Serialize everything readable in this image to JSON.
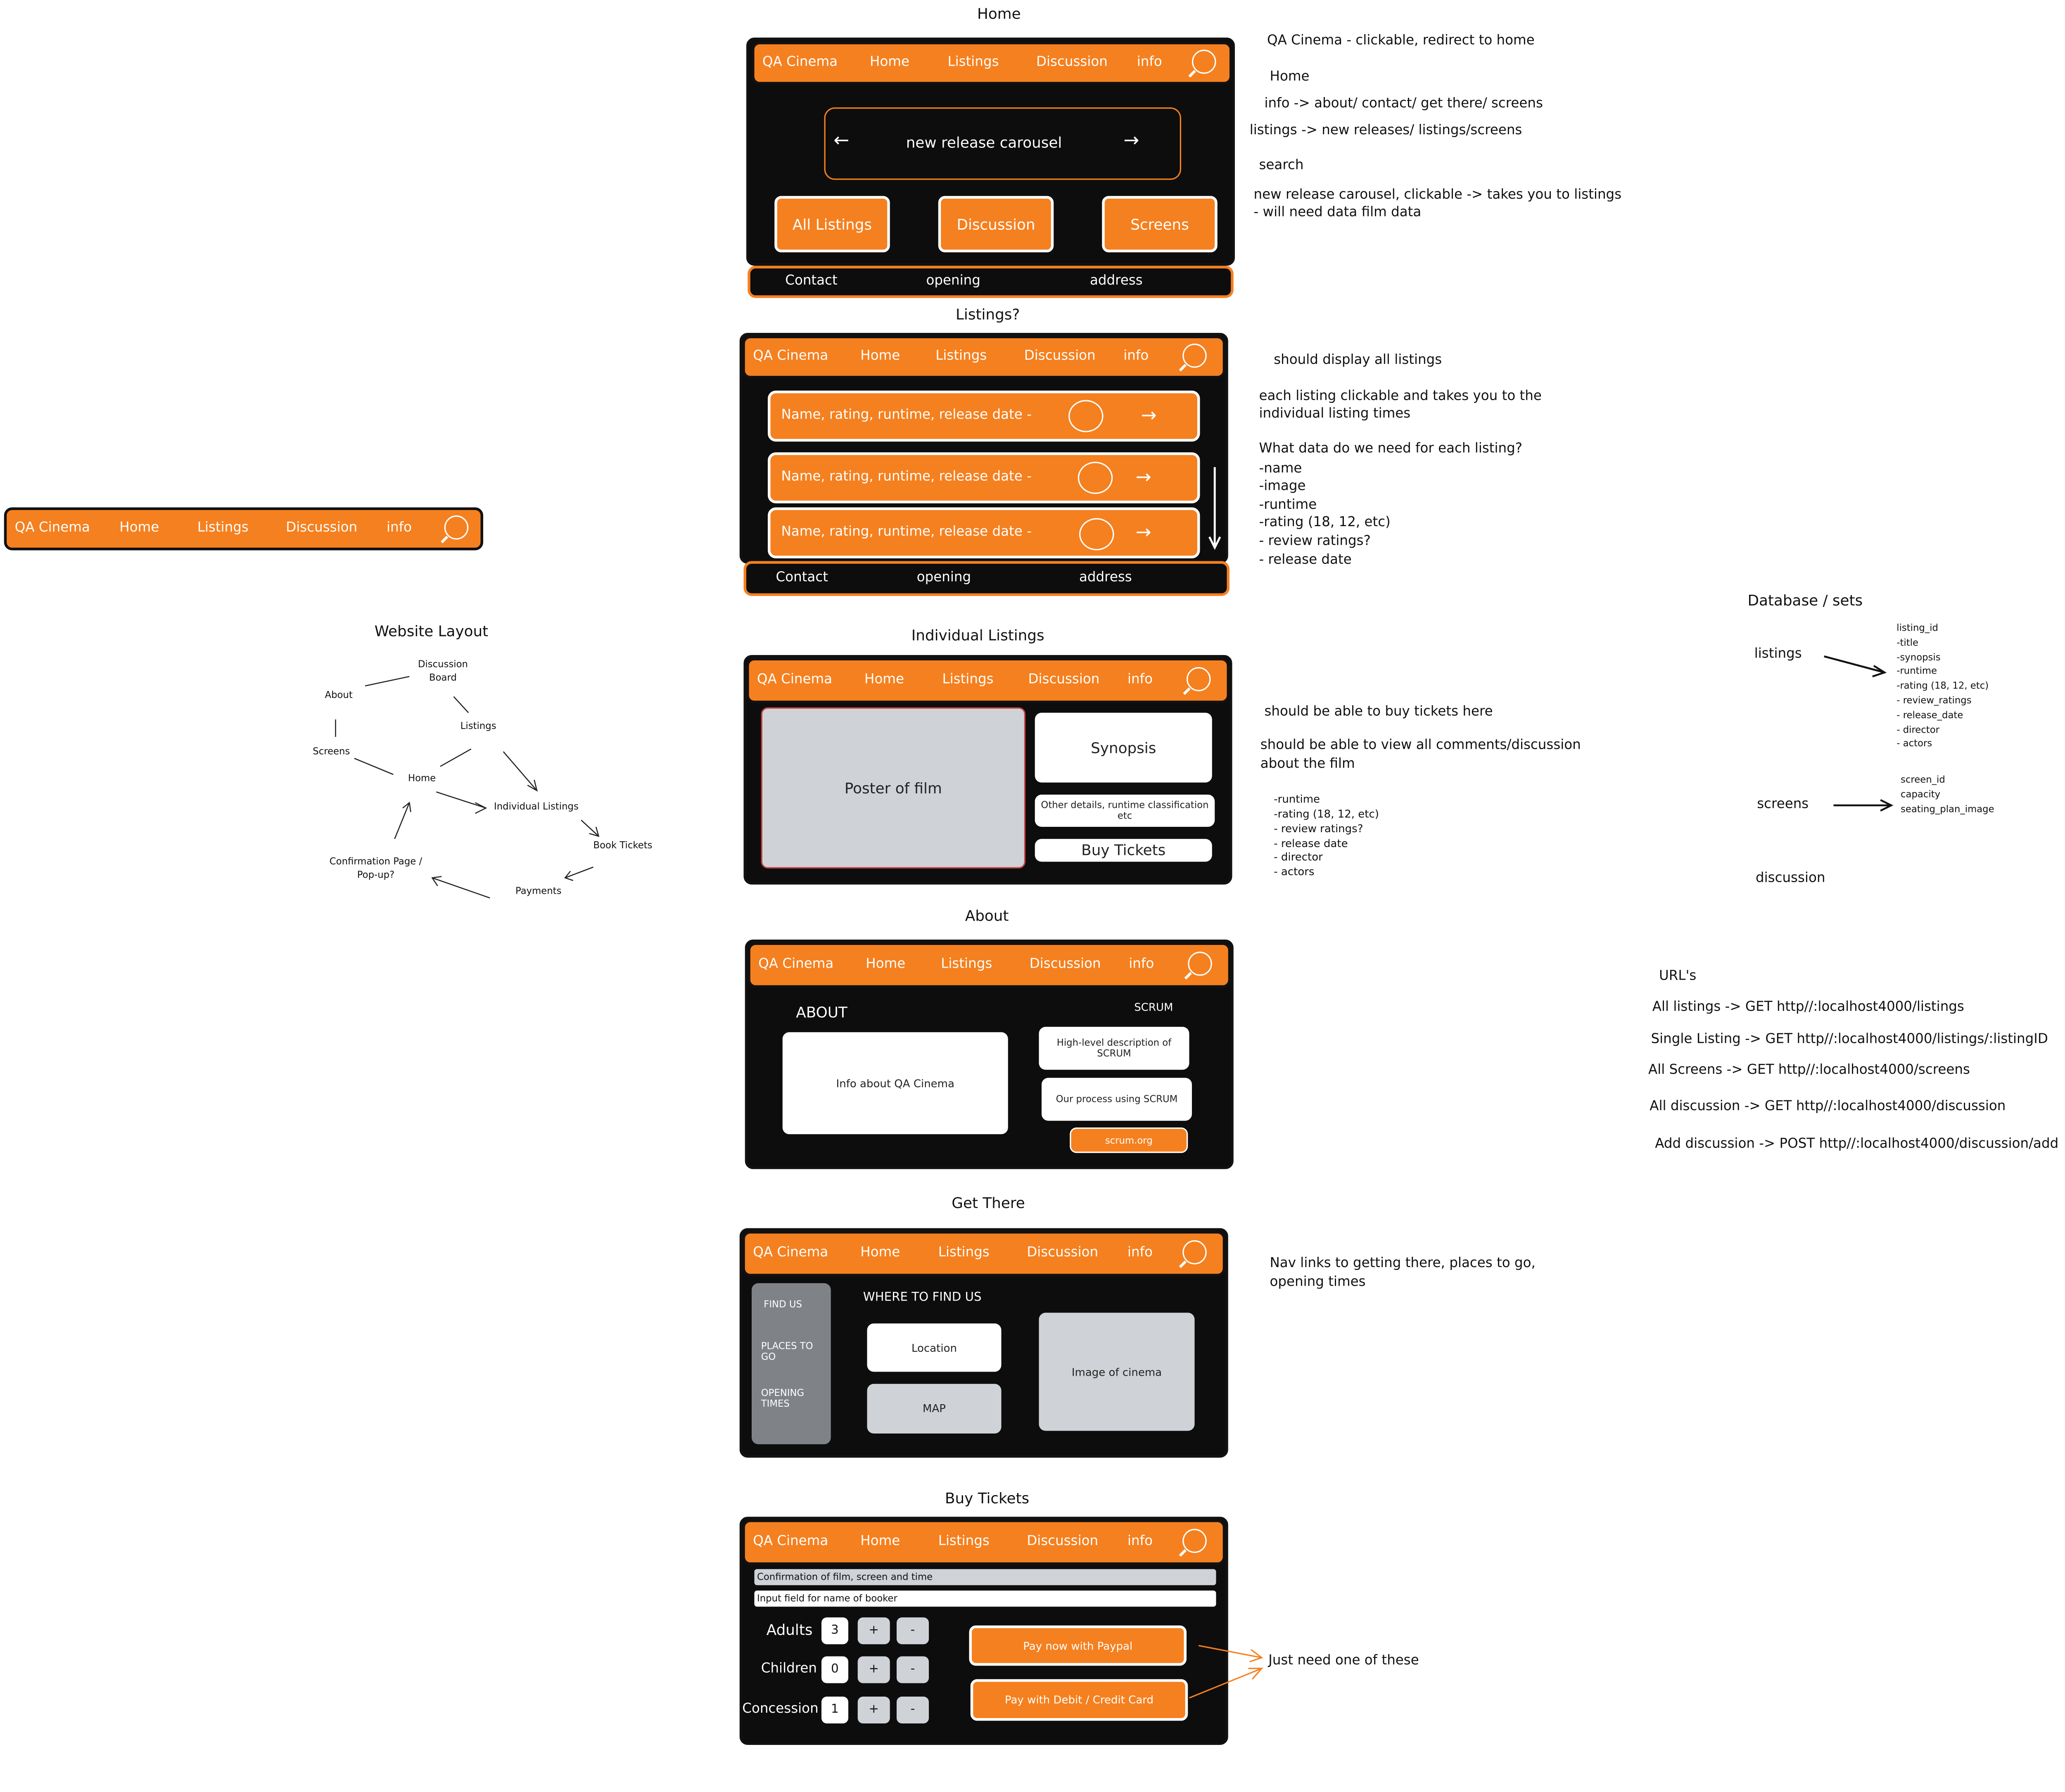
{
  "nav": {
    "logo": "QA Cinema",
    "home": "Home",
    "listings": "Listings",
    "discussion": "Discussion",
    "info": "info"
  },
  "footer": {
    "contact": "Contact",
    "opening": "opening",
    "address": "address"
  },
  "sections": {
    "home": {
      "title": "Home",
      "carousel": "new release carousel",
      "buttons": [
        "All Listings",
        "Discussion",
        "Screens"
      ],
      "notes": [
        "QA Cinema - clickable, redirect to home",
        "Home",
        "info -> about/ contact/ get there/ screens",
        "listings -> new releases/ listings/screens",
        "search",
        "new release carousel, clickable -> takes you to listings",
        "- will need data film data"
      ]
    },
    "listings": {
      "title": "Listings?",
      "row_text": "Name, rating, runtime, release date -",
      "notes": [
        "should display all listings",
        "each listing clickable and takes you to the",
        "individual listing times",
        "What data do we need for each listing?",
        "-name",
        "-image",
        "-runtime",
        "-rating (18, 12, etc)",
        "- review ratings?",
        "- release date"
      ]
    },
    "individual": {
      "title": "Individual Listings",
      "poster": "Poster of film",
      "synopsis": "Synopsis",
      "other": "Other details, runtime classification etc",
      "buy": "Buy Tickets",
      "notes": [
        "should be able to buy tickets here",
        "should be able to view all comments/discussion",
        "about the film"
      ],
      "fields": [
        "-runtime",
        "-rating (18, 12, etc)",
        "- review ratings?",
        "- release date",
        "- director",
        "- actors"
      ]
    },
    "about": {
      "title": "About",
      "heading": "ABOUT",
      "scrum": "SCRUM",
      "info": "Info about QA Cinema",
      "desc": "High-level description of SCRUM",
      "process": "Our process using SCRUM",
      "link": "scrum.org"
    },
    "get_there": {
      "title": "Get There",
      "side": [
        "FIND US",
        "PLACES TO GO",
        "OPENING TIMES"
      ],
      "heading": "WHERE TO FIND US",
      "location": "Location",
      "map": "MAP",
      "image": "Image of cinema",
      "notes": [
        "Nav links to getting there, places to go,",
        "opening times"
      ]
    },
    "buy": {
      "title": "Buy Tickets",
      "confirm": "Confirmation of film, screen and time",
      "input": "Input field for name of booker",
      "rows": [
        {
          "label": "Adults",
          "value": "3"
        },
        {
          "label": "Children",
          "value": "0"
        },
        {
          "label": "Concession",
          "value": "1"
        }
      ],
      "plus": "+",
      "minus": "-",
      "paypal": "Pay now with Paypal",
      "card": "Pay with Debit / Credit Card",
      "note": "Just need one of these"
    }
  },
  "layout": {
    "title": "Website Layout",
    "nodes": {
      "discussion": "Discussion Board",
      "about": "About",
      "listings": "Listings",
      "screens": "Screens",
      "home": "Home",
      "individual": "Individual Listings",
      "book": "Book Tickets",
      "confirmation": "Confirmation Page / Pop-up?",
      "payments": "Payments"
    }
  },
  "database": {
    "title": "Database / sets",
    "listings_label": "listings",
    "listings_fields": [
      "listing_id",
      "-title",
      "-synopsis",
      "-runtime",
      "-rating (18, 12, etc)",
      "- review_ratings",
      "- release_date",
      "- director",
      "- actors"
    ],
    "screens_label": "screens",
    "screens_fields": [
      "screen_id",
      "capacity",
      "seating_plan_image"
    ],
    "discussion_label": "discussion"
  },
  "urls": {
    "title": "URL's",
    "items": [
      "All listings -> GET http//:localhost4000/listings",
      "Single Listing -> GET http//:localhost4000/listings/:listingID",
      "All Screens -> GET http//:localhost4000/screens",
      "All discussion -> GET http//:localhost4000/discussion",
      "Add discussion -> POST http//:localhost4000/discussion/add"
    ]
  },
  "colors": {
    "accent": "#f5801f",
    "dark": "#0d0d0d",
    "grey": "#cfd3d8"
  }
}
